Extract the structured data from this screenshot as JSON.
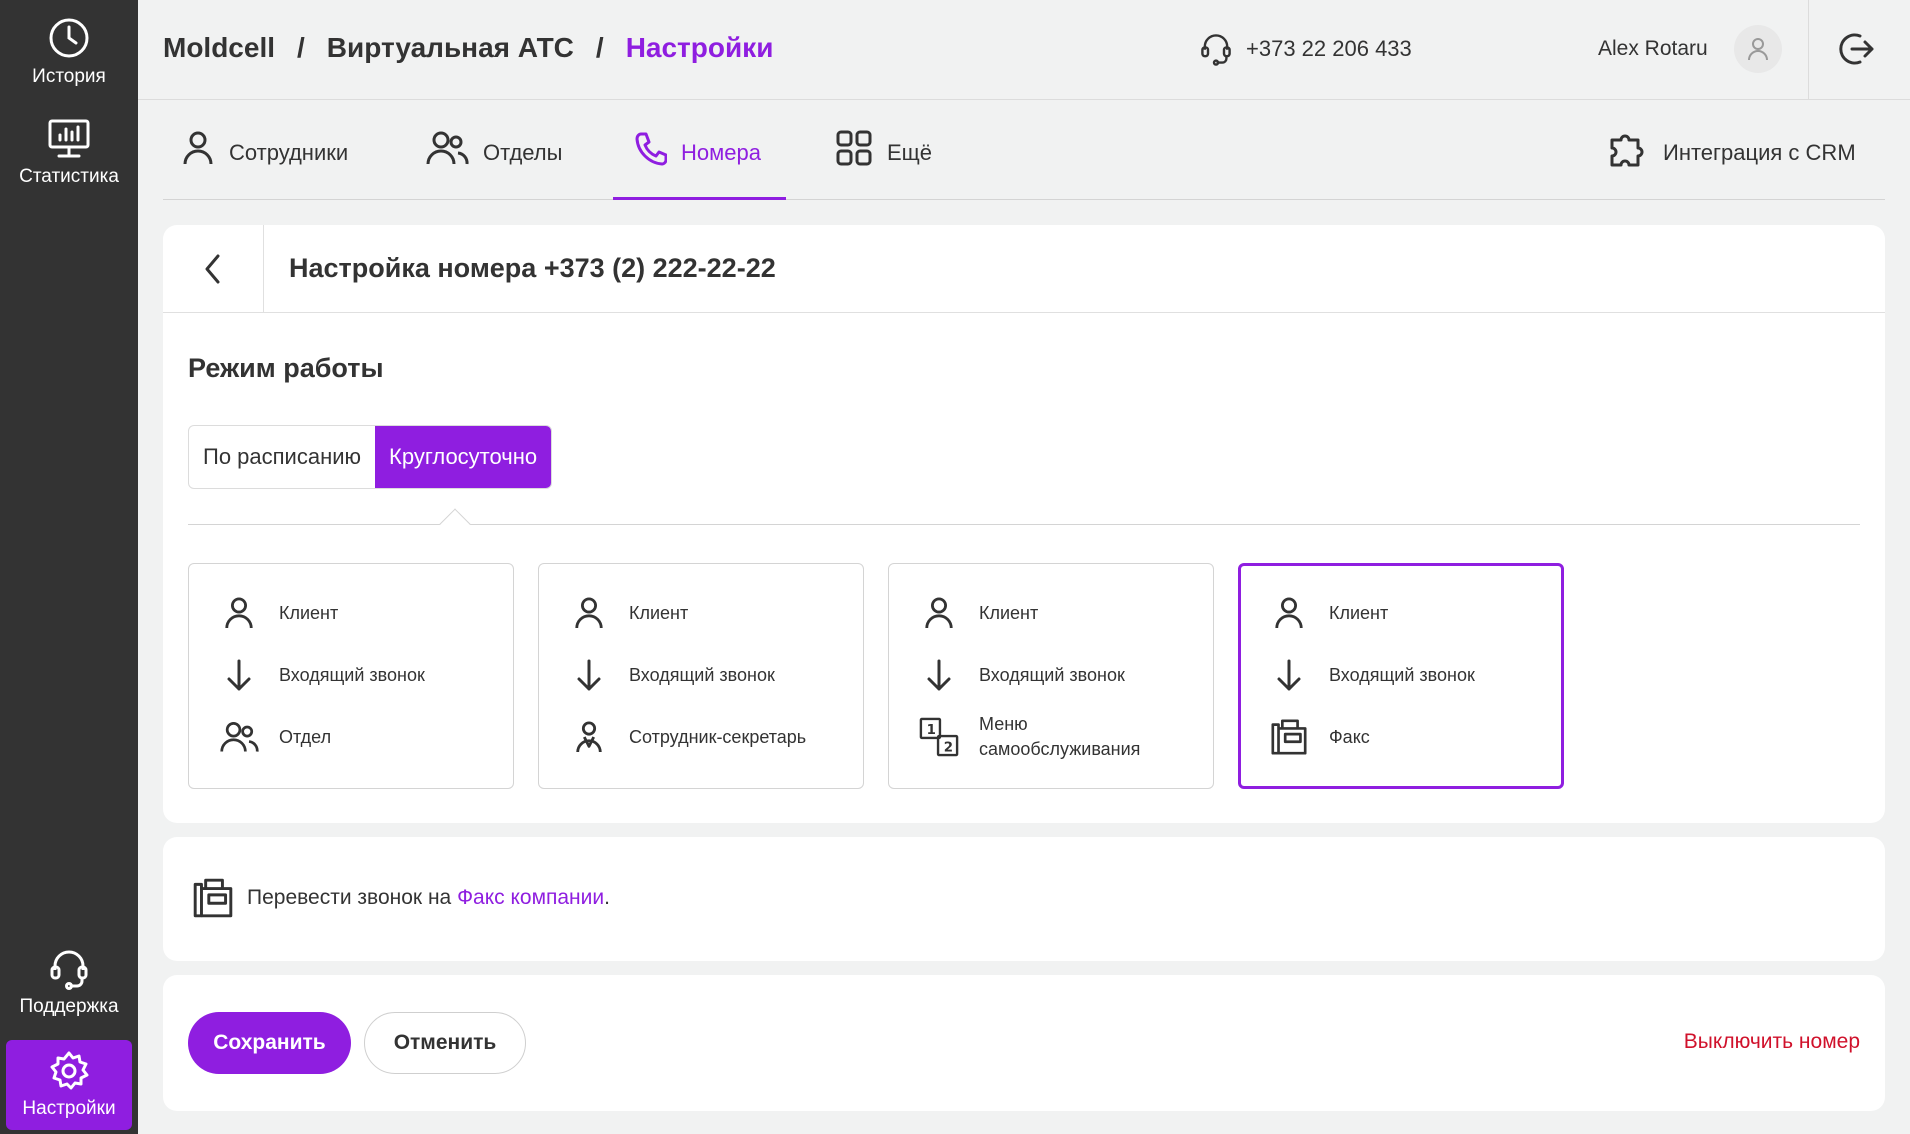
{
  "colors": {
    "accent": "#8f1ee0",
    "sidebar": "#333333",
    "danger": "#d0112b"
  },
  "sidebar": {
    "history": "История",
    "statistics": "Статистика",
    "support": "Поддержка",
    "settings": "Настройки"
  },
  "header": {
    "crumb1": "Moldcell",
    "crumb2": "Виртуальная АТС",
    "crumb3": "Настройки",
    "sep": "/",
    "phone": "+373 22 206 433",
    "user": "Alex Rotaru"
  },
  "tabs": {
    "employees": "Сотрудники",
    "departments": "Отделы",
    "numbers": "Номера",
    "more": "Ещё",
    "crm": "Интеграция с CRM"
  },
  "settings": {
    "title": "Настройка номера +373 (2) 222-22-22",
    "mode_title": "Режим работы",
    "mode_schedule": "По расписанию",
    "mode_24h": "Круглосуточно"
  },
  "schemes": [
    {
      "client": "Клиент",
      "incoming": "Входящий звонок",
      "target": "Отдел"
    },
    {
      "client": "Клиент",
      "incoming": "Входящий звонок",
      "target": "Сотрудник-секретарь"
    },
    {
      "client": "Клиент",
      "incoming": "Входящий звонок",
      "target_line1": "Меню",
      "target_line2": "самообслуживания"
    },
    {
      "client": "Клиент",
      "incoming": "Входящий звонок",
      "target": "Факс"
    }
  ],
  "forward": {
    "prefix": "Перевести звонок на",
    "link": "Факс компании",
    "suffix": "."
  },
  "actions": {
    "save": "Сохранить",
    "cancel": "Отменить",
    "disable": "Выключить номер"
  }
}
